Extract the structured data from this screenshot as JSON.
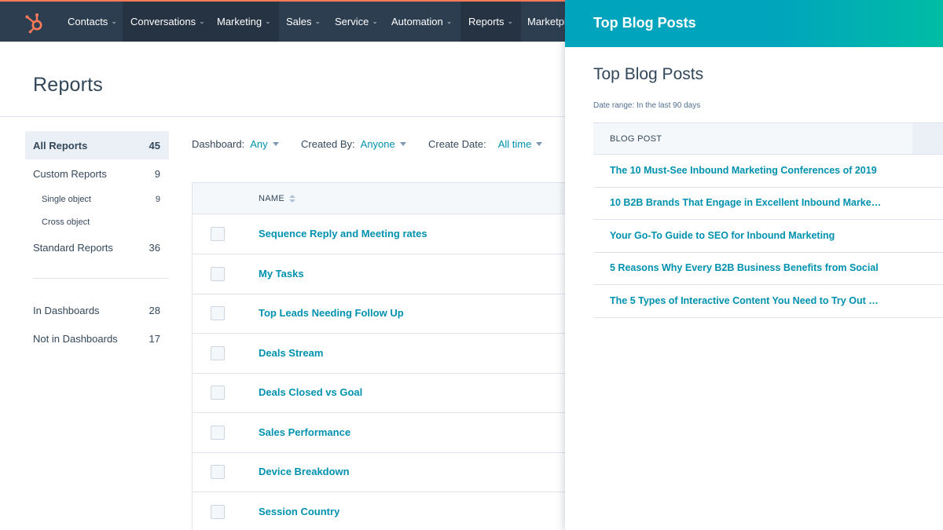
{
  "nav": {
    "items": [
      {
        "label": "Contacts"
      },
      {
        "label": "Conversations"
      },
      {
        "label": "Marketing"
      },
      {
        "label": "Sales"
      },
      {
        "label": "Service"
      },
      {
        "label": "Automation"
      },
      {
        "label": "Reports"
      },
      {
        "label": "Marketpl"
      }
    ],
    "brand_color": "#ff7a59",
    "bar_color": "#2d3e50"
  },
  "page": {
    "title": "Reports"
  },
  "sidebar": {
    "items": [
      {
        "label": "All Reports",
        "count": "45",
        "active": true
      },
      {
        "label": "Custom Reports",
        "count": "9"
      },
      {
        "label": "Single object",
        "count": "9"
      },
      {
        "label": "Cross object",
        "count": ""
      },
      {
        "label": "Standard Reports",
        "count": "36"
      },
      {
        "label": "In Dashboards",
        "count": "28"
      },
      {
        "label": "Not in Dashboards",
        "count": "17"
      }
    ]
  },
  "filters": {
    "dashboard": {
      "label": "Dashboard:",
      "value": "Any"
    },
    "created_by": {
      "label": "Created By:",
      "value": "Anyone"
    },
    "create_date": {
      "label": "Create Date:",
      "value": "All time"
    }
  },
  "table": {
    "header_name": "NAME",
    "rows": [
      "Sequence Reply and Meeting rates",
      "My Tasks",
      "Top Leads Needing Follow Up",
      "Deals Stream",
      "Deals Closed vs Goal",
      "Sales Performance",
      "Device Breakdown",
      "Session Country"
    ]
  },
  "panel": {
    "header_title": "Top Blog Posts",
    "title": "Top Blog Posts",
    "date_range": "Date range: In the last 90 days",
    "column_header": "BLOG POST",
    "posts": [
      "The 10 Must-See Inbound Marketing Conferences of 2019",
      "10 B2B Brands That Engage in Excellent Inbound Marke…",
      "Your Go-To Guide to SEO for Inbound Marketing",
      "5 Reasons Why Every B2B Business Benefits from Social …",
      "The 5 Types of Interactive Content You Need to Try Out …"
    ],
    "accent_color": "#00a4bd",
    "link_color": "#0091ae"
  }
}
